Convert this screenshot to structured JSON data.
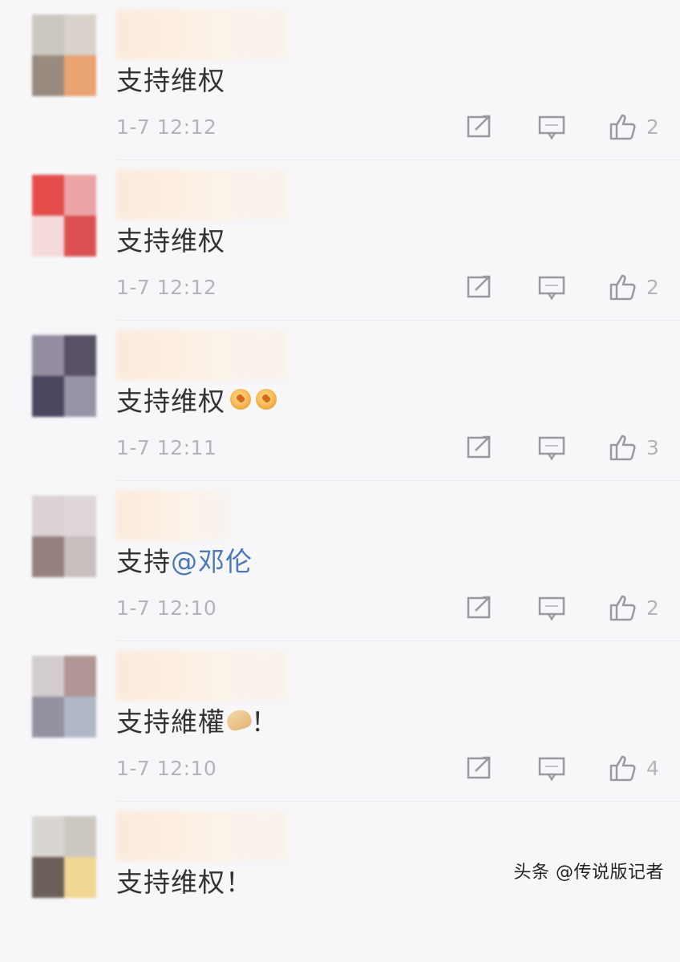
{
  "comments": [
    {
      "text": "支持维权",
      "time": "1-7 12:12",
      "likes": "2",
      "avatar_colors": [
        "#c9c2bc",
        "#d5cfc6",
        "#8f7f72",
        "#e99a64"
      ]
    },
    {
      "text": "支持维权",
      "time": "1-7 12:12",
      "likes": "2",
      "avatar_colors": [
        "#e23a3a",
        "#ea9c9c",
        "#f4d7d7",
        "#d84040"
      ]
    },
    {
      "text": "支持维权",
      "time": "1-7 12:11",
      "likes": "3",
      "avatar_colors": [
        "#8a8296",
        "#473f55",
        "#3a3350",
        "#8e8aa0"
      ]
    },
    {
      "text_prefix": "支持",
      "mention": "@邓伦",
      "time": "1-7 12:10",
      "likes": "2",
      "avatar_colors": [
        "#d8cfd0",
        "#dcd3d4",
        "#8d7474",
        "#c5b8b8"
      ]
    },
    {
      "text": "支持維權",
      "text_suffix": "！",
      "time": "1-7 12:10",
      "likes": "4",
      "avatar_colors": [
        "#cfc8c8",
        "#a98c8a",
        "#8c8696",
        "#aab0c4"
      ]
    },
    {
      "text": "支持维权！",
      "time": "",
      "likes": "",
      "avatar_colors": [
        "#d6d2cd",
        "#c9c3bd",
        "#5c5048",
        "#f1d489"
      ]
    }
  ],
  "watermark": "头条 @传说版记者",
  "icons": {
    "share": "share-icon",
    "reply": "comment-icon",
    "like": "thumbs-up-icon"
  }
}
